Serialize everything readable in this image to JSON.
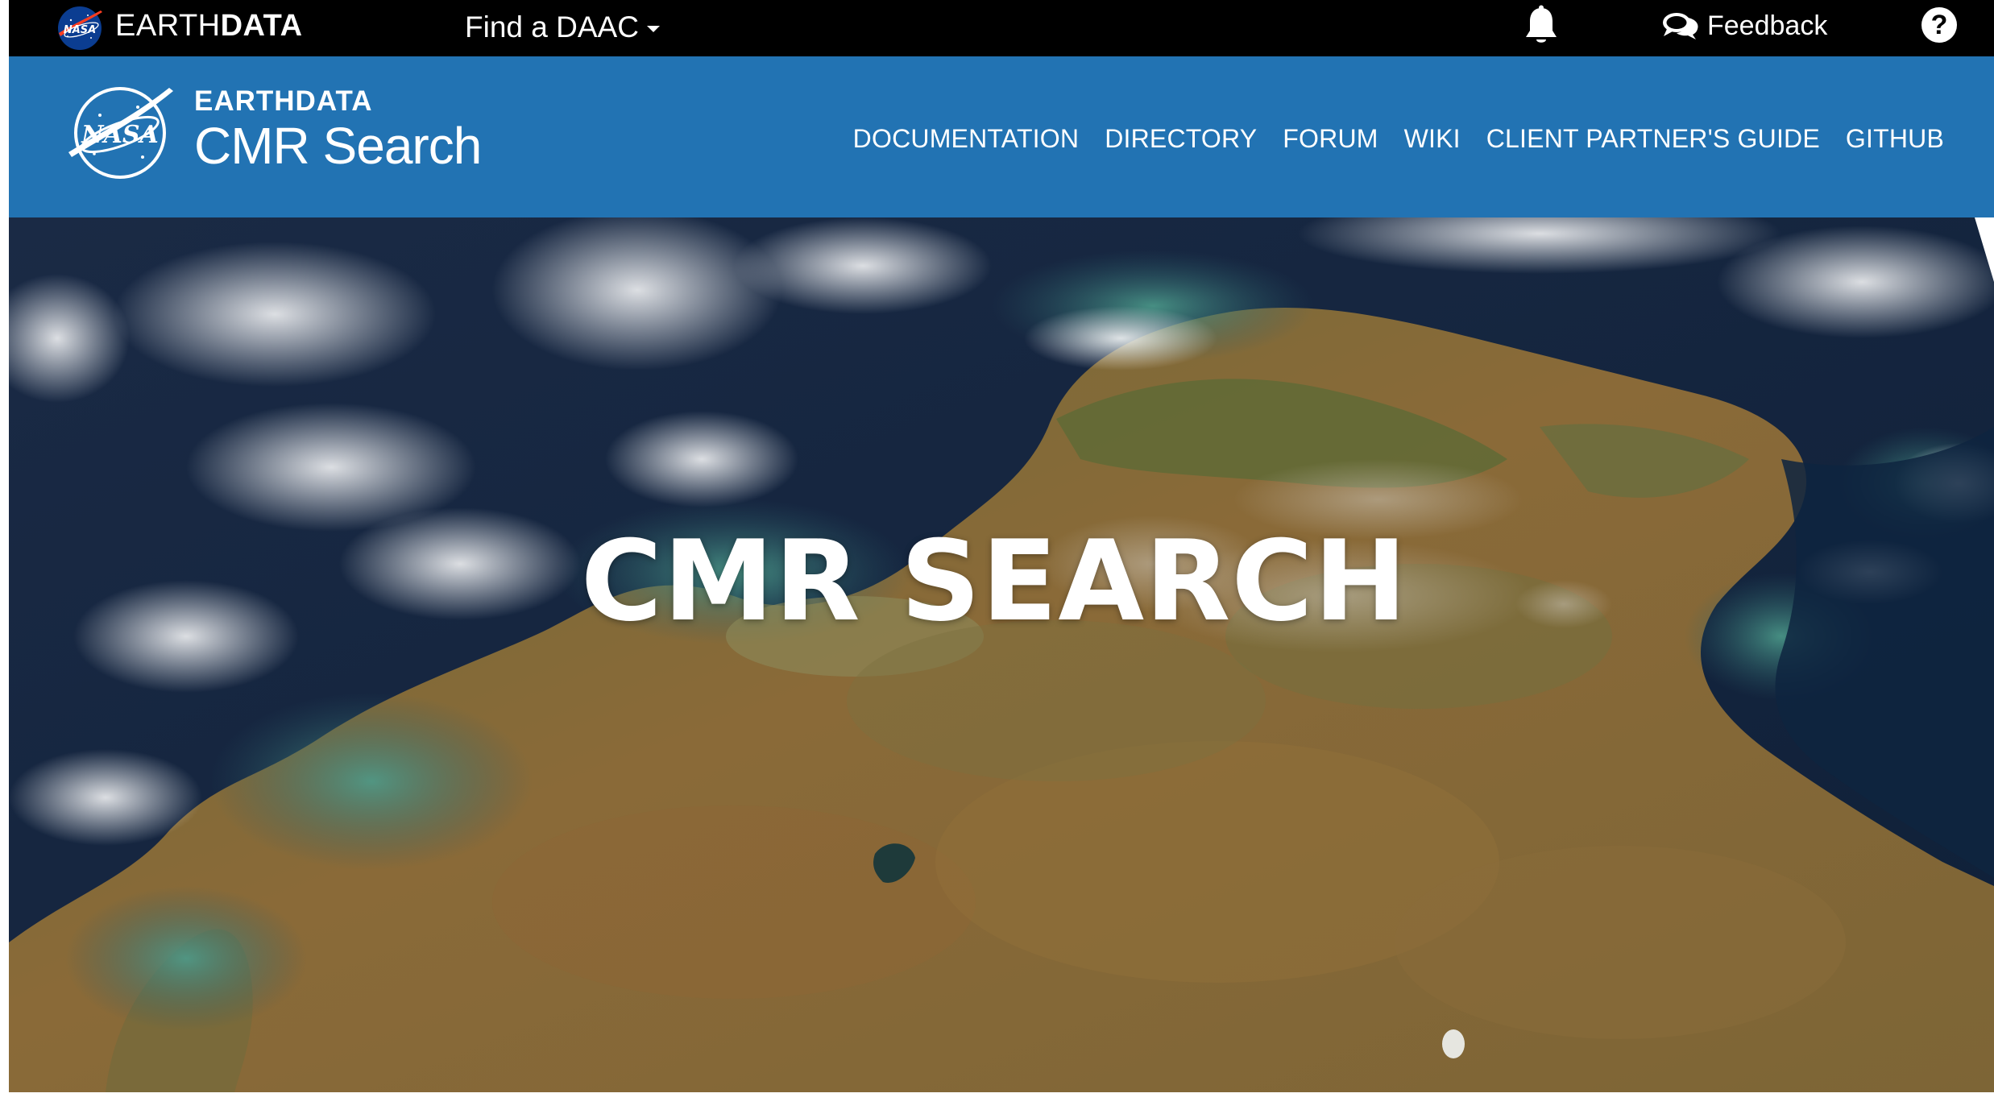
{
  "topbar": {
    "brand_light": "EARTH",
    "brand_bold": "DATA",
    "meatball_text": "NASA",
    "find_daac_label": "Find a DAAC",
    "feedback_label": "Feedback",
    "help_label": "?",
    "icons": {
      "logo": "nasa-meatball-icon",
      "dropdown": "caret-down-icon",
      "notifications": "bell-icon",
      "feedback": "speech-bubbles-icon",
      "help": "question-circle-icon"
    }
  },
  "header": {
    "eyebrow": "EARTHDATA",
    "title": "CMR Search",
    "logo_text": "NASA",
    "background_color": "#2273b3",
    "nav": [
      {
        "label": "DOCUMENTATION"
      },
      {
        "label": "DIRECTORY"
      },
      {
        "label": "FORUM"
      },
      {
        "label": "WIKI"
      },
      {
        "label": "CLIENT PARTNER'S GUIDE"
      },
      {
        "label": "GITHUB"
      }
    ]
  },
  "hero": {
    "title": "CMR SEARCH"
  },
  "colors": {
    "topbar": "#000000",
    "header": "#2273b3",
    "text": "#ffffff",
    "nasa_blue": "#0b3d91",
    "nasa_red": "#fc3d21"
  }
}
